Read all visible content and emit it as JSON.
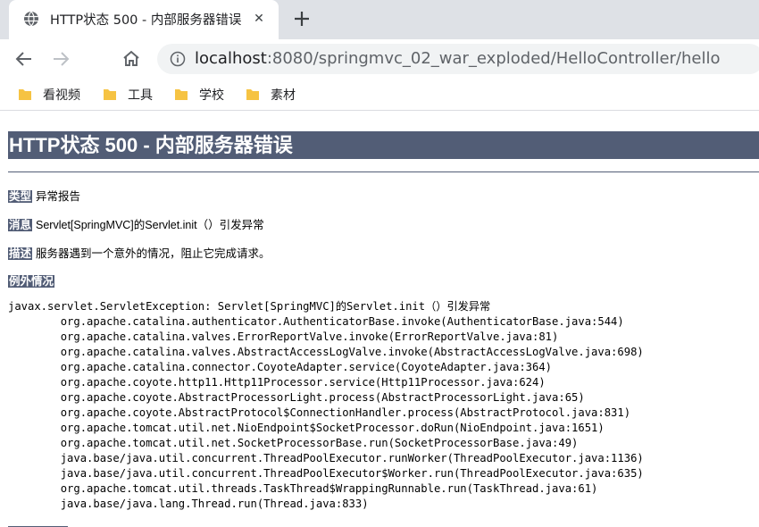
{
  "browser": {
    "tab": {
      "title": "HTTP状态 500 - 内部服务器错误",
      "close_glyph": "✕",
      "favicon": "globe-icon"
    },
    "new_tab_icon": "plus-icon",
    "nav": {
      "back_icon": "arrow-left-icon",
      "forward_icon": "arrow-right-icon",
      "home_icon": "home-icon"
    },
    "url": {
      "host": "localhost",
      "rest": ":8080/springmvc_02_war_exploded/HelloController/hello"
    },
    "bookmarks": [
      {
        "label": "看视频",
        "icon": "folder-icon"
      },
      {
        "label": "工具",
        "icon": "folder-icon"
      },
      {
        "label": "学校",
        "icon": "folder-icon"
      },
      {
        "label": "素材",
        "icon": "folder-icon"
      }
    ],
    "colors": {
      "tabstrip": "#dee1e6",
      "omnibox": "#f1f3f4",
      "folder": "#f6c343"
    }
  },
  "error_page": {
    "heading": "HTTP状态 500 - 内部服务器错误",
    "type": {
      "label": "类型",
      "value": "异常报告"
    },
    "message": {
      "label": "消息",
      "value": "Servlet[SpringMVC]的Servlet.init（）引发异常"
    },
    "description": {
      "label": "描述",
      "value": "服务器遇到一个意外的情况，阻止它完成请求。"
    },
    "exception": {
      "label": "例外情况"
    },
    "stack_trace": [
      "javax.servlet.ServletException: Servlet[SpringMVC]的Servlet.init（）引发异常",
      "\torg.apache.catalina.authenticator.AuthenticatorBase.invoke(AuthenticatorBase.java:544)",
      "\torg.apache.catalina.valves.ErrorReportValve.invoke(ErrorReportValve.java:81)",
      "\torg.apache.catalina.valves.AbstractAccessLogValve.invoke(AbstractAccessLogValve.java:698)",
      "\torg.apache.catalina.connector.CoyoteAdapter.service(CoyoteAdapter.java:364)",
      "\torg.apache.coyote.http11.Http11Processor.service(Http11Processor.java:624)",
      "\torg.apache.coyote.AbstractProcessorLight.process(AbstractProcessorLight.java:65)",
      "\torg.apache.coyote.AbstractProtocol$ConnectionHandler.process(AbstractProtocol.java:831)",
      "\torg.apache.tomcat.util.net.NioEndpoint$SocketProcessor.doRun(NioEndpoint.java:1651)",
      "\torg.apache.tomcat.util.net.SocketProcessorBase.run(SocketProcessorBase.java:49)",
      "\tjava.base/java.util.concurrent.ThreadPoolExecutor.runWorker(ThreadPoolExecutor.java:1136)",
      "\tjava.base/java.util.concurrent.ThreadPoolExecutor$Worker.run(ThreadPoolExecutor.java:635)",
      "\torg.apache.tomcat.util.threads.TaskThread$WrappingRunnable.run(TaskThread.java:61)",
      "\tjava.base/java.lang.Thread.run(Thread.java:833)"
    ],
    "colors": {
      "label_bg": "#525d76",
      "label_fg": "#ffffff"
    }
  }
}
